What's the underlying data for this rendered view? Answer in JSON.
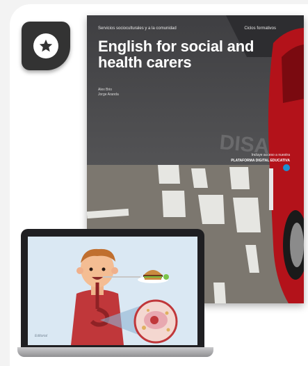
{
  "badge": {
    "icon": "star-icon"
  },
  "book": {
    "series": "Servicios socioculturales y a la comunidad",
    "edition": "Ciclos formativos",
    "title": "English for social and health carers",
    "authors": [
      "Alex Brio",
      "Jorge Aranda"
    ],
    "platform_label": "Incluye acceso a nuestra",
    "platform_name": "PLATAFORMA DIGITAL EDUCATIVA"
  },
  "laptop": {
    "screen_signature": "Editorial"
  },
  "colors": {
    "background": "#f3f3f3",
    "badge": "#333333",
    "platform_icon": "#1e8fd1",
    "car_red": "#b3121a"
  }
}
